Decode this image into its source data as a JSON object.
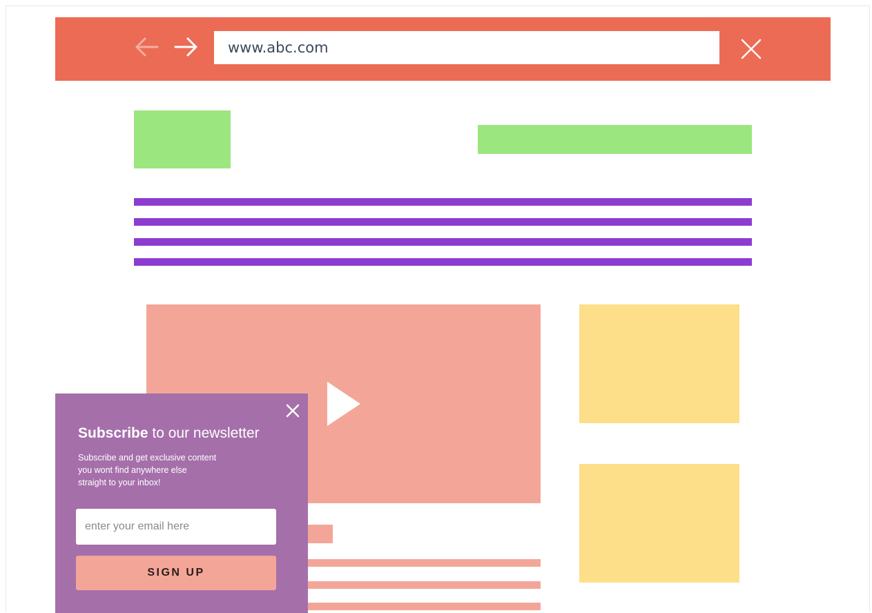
{
  "colors": {
    "browser_bar": "#ec6b55",
    "green_blocks": "#9ce67f",
    "purple_lines": "#8c3cd1",
    "salmon_blocks": "#f3a698",
    "yellow_blocks": "#fddf89",
    "popup_bg": "#a56faa"
  },
  "browser": {
    "back_icon": "arrow-left-icon",
    "forward_icon": "arrow-right-icon",
    "url": "www.abc.com",
    "close_icon": "close-icon"
  },
  "page": {
    "video_icon": "play-icon"
  },
  "popup": {
    "close_icon": "close-icon",
    "title_bold": "Subscribe",
    "title_rest": " to our newsletter",
    "body_lines": [
      "Subscribe and get exclusive content",
      "you wont find anywhere else",
      "straight to your inbox!"
    ],
    "email_placeholder": "enter your email here",
    "button_label": "SIGN UP"
  }
}
